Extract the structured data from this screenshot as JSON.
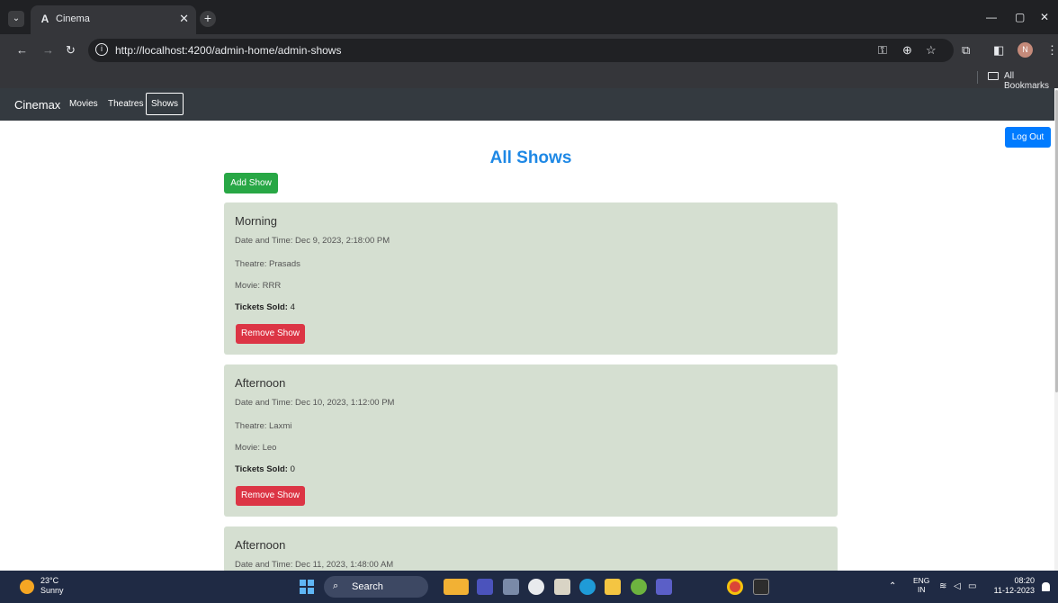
{
  "browser": {
    "tab_title": "Cinema",
    "tab_favicon": "A",
    "url": "http://localhost:4200/admin-home/admin-shows",
    "bookmarks_label": "All Bookmarks",
    "profile_initial": "N"
  },
  "navbar": {
    "brand": "Cinemax",
    "links": [
      "Movies",
      "Theatres",
      "Shows"
    ],
    "active": "Shows"
  },
  "page": {
    "logout_label": "Log Out",
    "title": "All Shows",
    "add_show_label": "Add Show"
  },
  "shows": [
    {
      "name": "Morning",
      "datetime": "Date and Time: Dec 9, 2023, 2:18:00 PM",
      "theatre": "Theatre: Prasads",
      "movie": "Movie: RRR",
      "tickets_label": "Tickets Sold:",
      "tickets_value": "4",
      "remove_label": "Remove Show"
    },
    {
      "name": "Afternoon",
      "datetime": "Date and Time: Dec 10, 2023, 1:12:00 PM",
      "theatre": "Theatre: Laxmi",
      "movie": "Movie: Leo",
      "tickets_label": "Tickets Sold:",
      "tickets_value": "0",
      "remove_label": "Remove Show"
    },
    {
      "name": "Afternoon",
      "datetime": "Date and Time: Dec 11, 2023, 1:48:00 AM"
    }
  ],
  "taskbar": {
    "temperature": "23°C",
    "weather": "Sunny",
    "search_label": "Search",
    "lang_primary": "ENG",
    "lang_secondary": "IN",
    "time": "08:20",
    "date": "11-12-2023"
  },
  "colors": {
    "navbar": "#343a40",
    "primary": "#007bff",
    "success": "#28a745",
    "danger": "#dc3545",
    "card": "#d5dfd1",
    "title": "#1e88e5"
  }
}
